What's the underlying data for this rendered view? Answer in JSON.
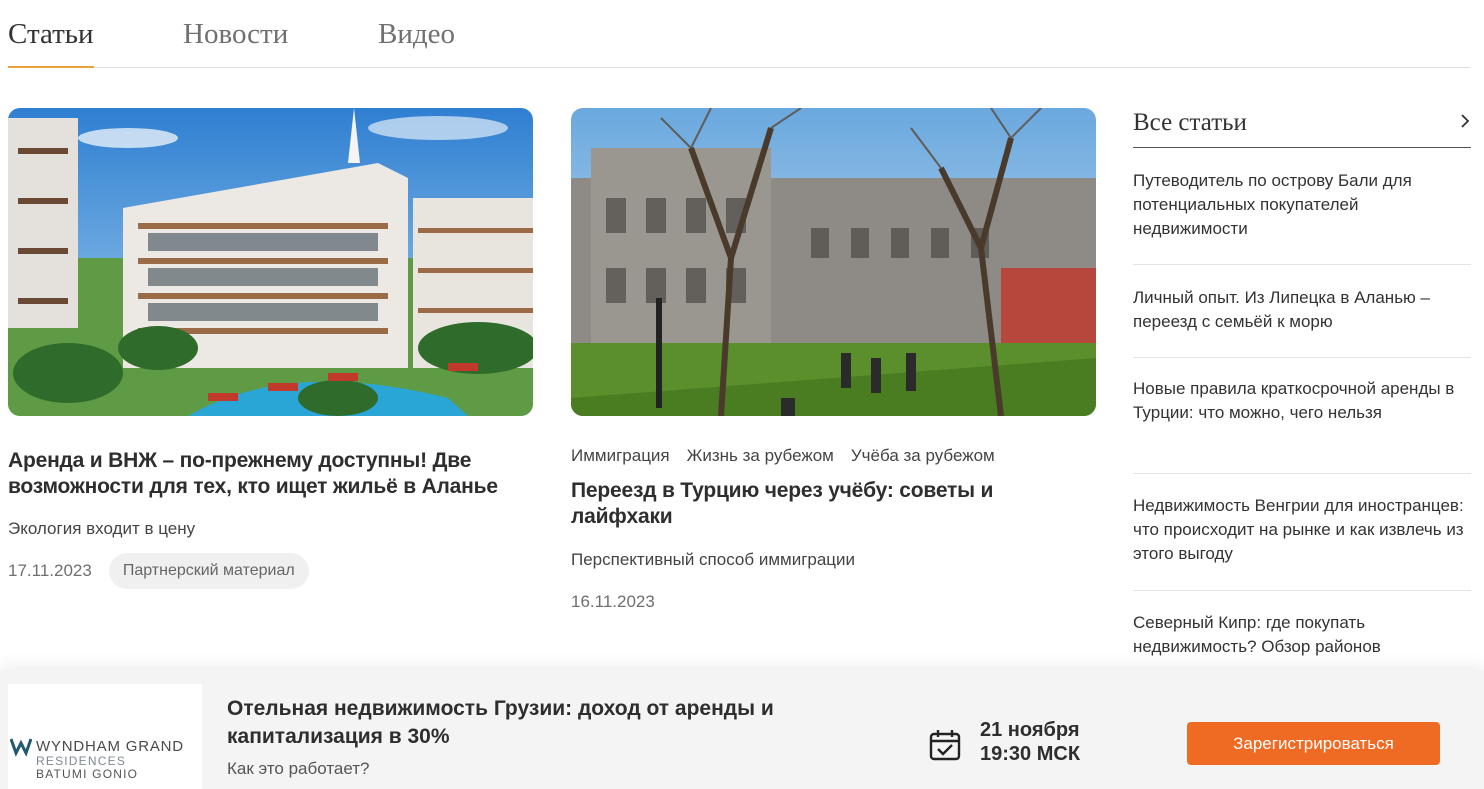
{
  "tabs": [
    {
      "label": "Статьи",
      "active": true
    },
    {
      "label": "Новости",
      "active": false
    },
    {
      "label": "Видео",
      "active": false
    }
  ],
  "cards": [
    {
      "title": "Аренда и ВНЖ – по-прежнему доступны! Две возможности для тех, кто ищет жильё в Аланье",
      "subtitle": "Экология входит в цену",
      "date": "17.11.2023",
      "badge": "Партнерский материал",
      "image": "apartment-complex-render"
    },
    {
      "tags": [
        "Иммиграция",
        "Жизнь за рубежом",
        "Учёба за рубежом"
      ],
      "title": "Переезд в Турцию через учёбу: советы и лайфхаки",
      "subtitle": "Перспективный способ иммиграции",
      "date": "16.11.2023",
      "image": "university-campus-photo"
    }
  ],
  "sidebar": {
    "heading": "Все статьи",
    "items": [
      {
        "label": "Путеводитель по острову Бали для потенциальных покупателей недвижимости"
      },
      {
        "label": "Личный опыт. Из Липецка в Аланью – переезд с семьёй к морю"
      },
      {
        "label": "Новые правила краткосрочной аренды в Турции: что можно, чего нельзя"
      },
      {
        "label": "Недвижимость Венгрии для иностранцев: что происходит на рынке и как извлечь из этого выгоду"
      },
      {
        "label": "Северный Кипр: где покупать недвижимость? Обзор районов"
      }
    ]
  },
  "banner": {
    "logo": {
      "line1": "WYNDHAM GRAND",
      "line2": "RESIDENCES",
      "line3": "BATUMI GONIO"
    },
    "title": "Отельная недвижимость Грузии: доход от аренды и капитализация в 30%",
    "subtitle": "Как это работает?",
    "date_line1": "21 ноября",
    "date_line2": "19:30 МСК",
    "button_label": "Зарегистрироваться",
    "accent": "#ef6a23"
  },
  "colors": {
    "tab_underline": "#e8a13b"
  }
}
